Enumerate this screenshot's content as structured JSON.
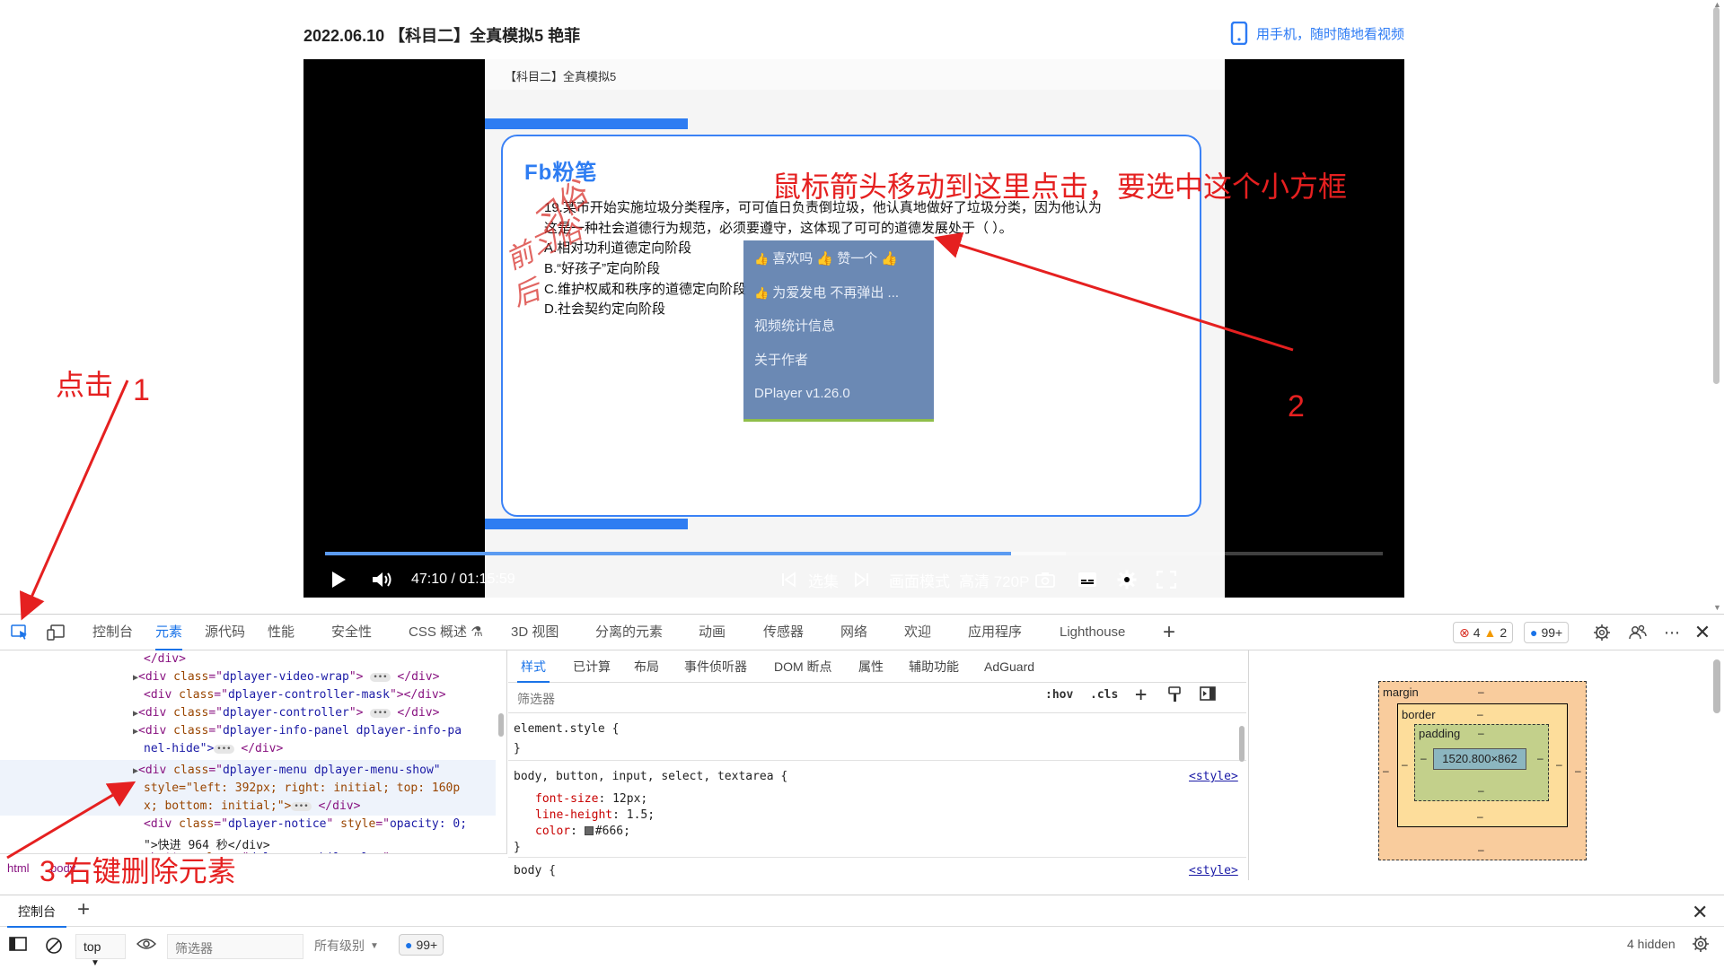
{
  "page": {
    "title": "2022.06.10 【科目二】全真模拟5 艳菲",
    "mobile_link": "用手机，随时随地看视频"
  },
  "video": {
    "slide_title": "【科目二】全真模拟5",
    "brand": "粉笔",
    "question_lines": [
      "19.某市开始实施垃圾分类程序，可可值日负责倒垃圾，他认真地做好了垃圾分类，因为他认为",
      "这是一种社会道德行为规范，必须要遵守，这体现了可可的道德发展处于（  ）。",
      "A.相对功利道德定向阶段",
      "B.“好孩子”定向阶段",
      "C.维护权威和秩序的道德定向阶段",
      "D.社会契约定向阶段"
    ],
    "handwriting": [
      "前习俗",
      "习俗",
      "后"
    ],
    "context_menu": [
      {
        "thumb": "👍",
        "label": "喜欢吗  👍  赞一个  👍"
      },
      {
        "thumb": "👍",
        "label": "为爱发电 不再弹出 ..."
      },
      {
        "thumb": "",
        "label": "视频统计信息"
      },
      {
        "thumb": "",
        "label": "关于作者"
      },
      {
        "thumb": "",
        "label": "DPlayer v1.26.0"
      }
    ],
    "annotation_note": "鼠标箭头移动到这里点击，要选中这个小方框",
    "annotation_num": "2",
    "progress": {
      "played": 0.6485,
      "loaded": 0.7
    }
  },
  "controls": {
    "time": "47:10 / 01:15:59",
    "episodes": "选集",
    "picture_mode": "画面模式",
    "quality": "高清 720P"
  },
  "annotations": {
    "click_label": "点击",
    "click_num": "1",
    "step3": "3 右键删除元素"
  },
  "devtools": {
    "tabs": [
      "控制台",
      "元素",
      "源代码",
      "性能",
      "安全性",
      "CSS 概述",
      "3D 视图",
      "分离的元素",
      "动画",
      "传感器",
      "网络",
      "欢迎",
      "应用程序",
      "Lighthouse"
    ],
    "active_tab": "元素",
    "errors": "4",
    "warnings": "2",
    "messages": "99+",
    "dom_lines": [
      {
        "kind": "close",
        "text": "</div>"
      },
      {
        "kind": "div",
        "cls": "dplayer-video-wrap",
        "extra": "",
        "ellipsis": true
      },
      {
        "kind": "div-empty",
        "cls": "dplayer-controller-mask"
      },
      {
        "kind": "div",
        "cls": "dplayer-controller",
        "extra": "",
        "ellipsis": true
      },
      {
        "kind": "div",
        "cls": "dplayer-info-panel dplayer-info-pa",
        "extra": "",
        "ellipsis": false
      },
      {
        "kind": "cont",
        "text": "nel-hide\">",
        "ellipsis": true
      },
      {
        "kind": "div-sel",
        "cls": "dplayer-menu dplayer-menu-show\"",
        "extra": ""
      },
      {
        "kind": "attr-cont",
        "text": "style=\"left: 392px; right: initial; top: 160p"
      },
      {
        "kind": "attr-cont2",
        "text": "x; bottom: initial;\">"
      },
      {
        "kind": "div-notice",
        "cls": "dplayer-notice",
        "extra": "opacity: 0;"
      },
      {
        "kind": "text-cont",
        "text": "\">快进 964 秒</div>"
      },
      {
        "kind": "div-mobile",
        "cls": "dplayer-mobile-play",
        "extra": ""
      }
    ],
    "breadcrumbs": [
      "html",
      "body"
    ],
    "style_subtabs": [
      "样式",
      "已计算",
      "布局",
      "事件侦听器",
      "DOM 断点",
      "属性",
      "辅助功能",
      "AdGuard"
    ],
    "filter_placeholder": "筛选器",
    "filter_tools": [
      ":hov",
      ".cls"
    ],
    "rules": {
      "element_style": "element.style {",
      "close": "}",
      "body_sel": "body, button, input, select, textarea {",
      "source": "<style>",
      "props": [
        {
          "name": "font-size",
          "value": "12px;"
        },
        {
          "name": "line-height",
          "value": "1.5;"
        },
        {
          "name": "color",
          "value": "#666;"
        }
      ],
      "body2": "body {"
    },
    "box_model": {
      "margin": "margin",
      "border": "border",
      "padding": "padding",
      "content": "1520.800×862",
      "dash": "–"
    },
    "drawer_tab": "控制台",
    "console": {
      "context": "top",
      "filter": "筛选器",
      "levels": "所有级别",
      "count": "99+",
      "hidden": "4 hidden"
    }
  }
}
